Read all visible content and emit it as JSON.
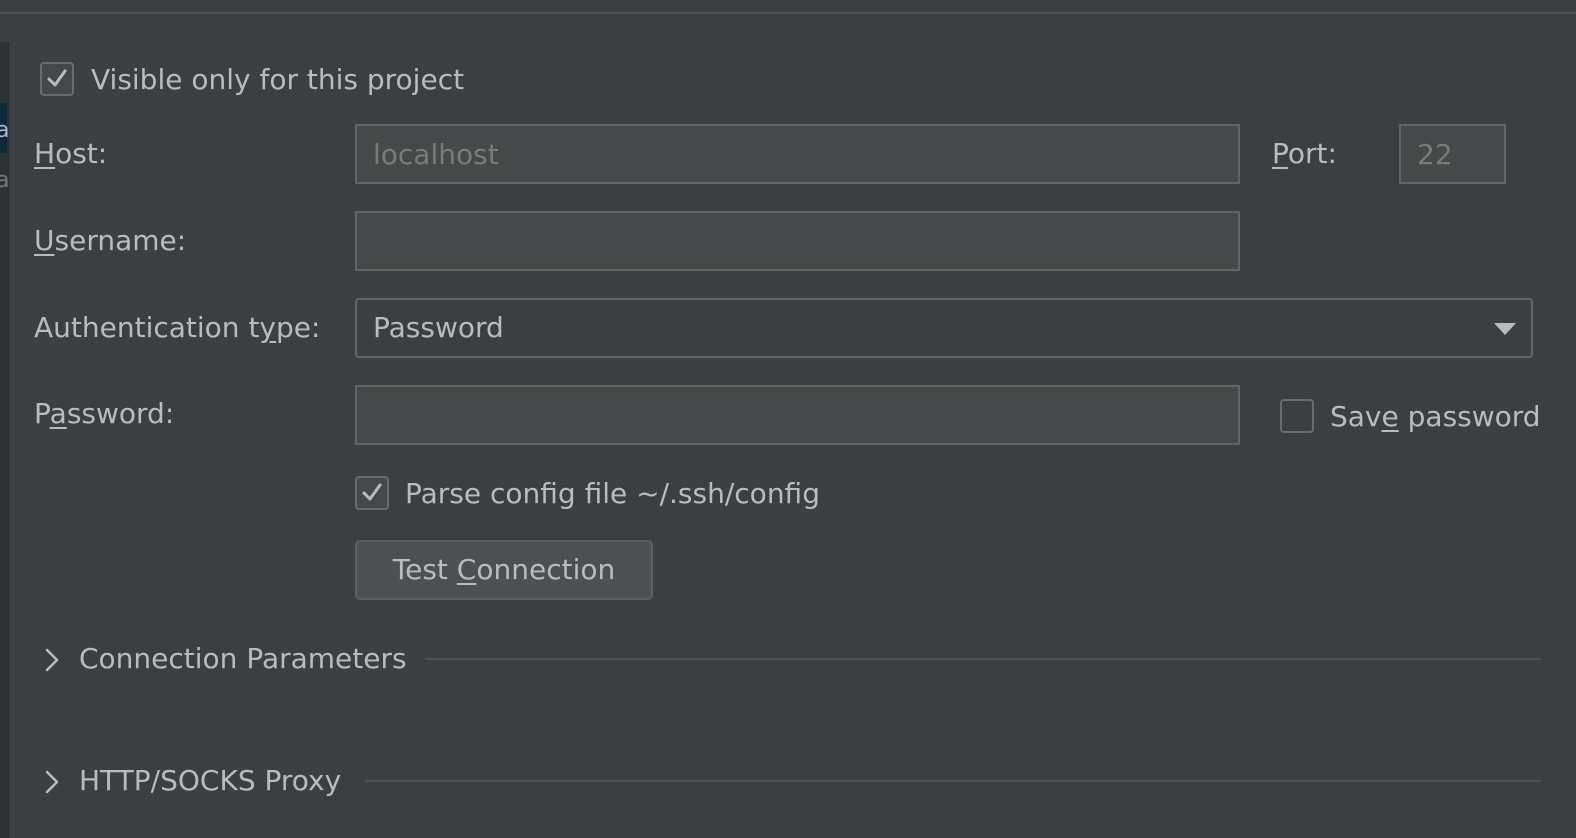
{
  "visible_only": {
    "label": "Visible only for this project",
    "checked": true
  },
  "host": {
    "label_mn": "H",
    "label_rest": "ost:",
    "value": "localhost"
  },
  "port": {
    "label_mn": "P",
    "label_rest": "ort:",
    "value": "22"
  },
  "username": {
    "label_mn": "U",
    "label_rest": "sername:",
    "value": ""
  },
  "auth_type": {
    "label_pre": "Authentication t",
    "label_mn": "y",
    "label_post": "pe:",
    "value": "Password"
  },
  "password": {
    "label_pre": "P",
    "label_mn": "a",
    "label_post": "ssword:",
    "value": ""
  },
  "save_password": {
    "label_pre": "Sav",
    "label_mn": "e",
    "label_post": " password",
    "checked": false
  },
  "parse_config": {
    "label": "Parse config file ~/.ssh/config",
    "checked": true
  },
  "test_connection": {
    "label_pre": "Test ",
    "label_mn": "C",
    "label_post": "onnection"
  },
  "sections": {
    "connection_params": {
      "title": "Connection Parameters"
    },
    "proxy": {
      "title": "HTTP/SOCKS Proxy"
    }
  },
  "colors": {
    "background": "#3c3f41",
    "field": "#45494a",
    "text": "#bbbbbb",
    "disabled_text": "#7b7b7b"
  }
}
